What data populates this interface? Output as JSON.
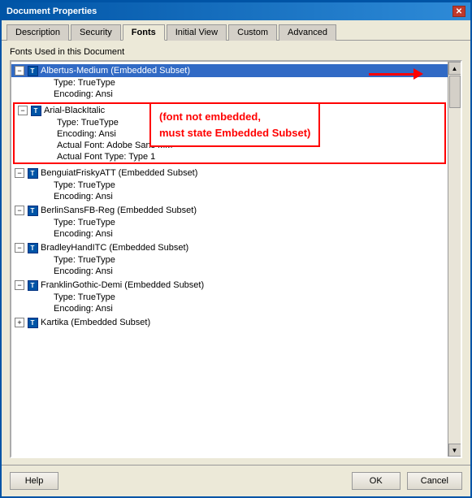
{
  "window": {
    "title": "Document Properties",
    "close_label": "✕"
  },
  "tabs": [
    {
      "label": "Description",
      "active": false
    },
    {
      "label": "Security",
      "active": false
    },
    {
      "label": "Fonts",
      "active": true
    },
    {
      "label": "Initial View",
      "active": false
    },
    {
      "label": "Custom",
      "active": false
    },
    {
      "label": "Advanced",
      "active": false
    }
  ],
  "section": {
    "label": "Fonts Used in this Document"
  },
  "fonts": [
    {
      "name": "Albertus-Medium (Embedded Subset)",
      "props": [
        "Type: TrueType",
        "Encoding: Ansi"
      ],
      "highlighted": true,
      "has_arrow": true
    },
    {
      "name": "Arial-BlackItalic",
      "props": [
        "Type: TrueType",
        "Encoding: Ansi",
        "Actual Font: Adobe Sans MM",
        "Actual Font Type: Type 1"
      ],
      "highlighted": false,
      "annotated": true
    },
    {
      "name": "BenguiatFriskyATT (Embedded Subset)",
      "props": [
        "Type: TrueType",
        "Encoding: Ansi"
      ],
      "highlighted": false
    },
    {
      "name": "BerlinSansFB-Reg (Embedded Subset)",
      "props": [
        "Type: TrueType",
        "Encoding: Ansi"
      ],
      "highlighted": false
    },
    {
      "name": "BradleyHandITC (Embedded Subset)",
      "props": [
        "Type: TrueType",
        "Encoding: Ansi"
      ],
      "highlighted": false
    },
    {
      "name": "FranklinGothic-Demi (Embedded Subset)",
      "props": [
        "Type: TrueType",
        "Encoding: Ansi"
      ],
      "highlighted": false
    },
    {
      "name": "Kartika (Embedded Subset)",
      "props": [],
      "highlighted": false
    }
  ],
  "annotation": {
    "line1": "(font not embedded,",
    "line2": "must state Embedded Subset)"
  },
  "buttons": {
    "help": "Help",
    "ok": "OK",
    "cancel": "Cancel"
  }
}
